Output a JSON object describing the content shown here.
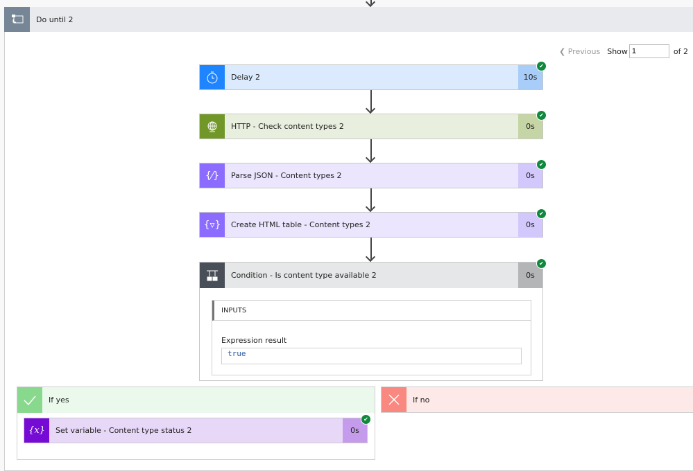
{
  "loop": {
    "title": "Do until 2",
    "icon": "do-until-icon"
  },
  "pager": {
    "previous": "Previous",
    "show": "Show",
    "value": "1",
    "of": "of 2"
  },
  "actions": [
    {
      "title": "Delay 2",
      "duration": "10s",
      "icon": "timer-icon",
      "status": "succeeded",
      "colors": {
        "icon": "#1f85ff",
        "body": "#dceafd",
        "duration": "#a8cdf9"
      }
    },
    {
      "title": "HTTP - Check content types 2",
      "duration": "0s",
      "icon": "globe-icon",
      "status": "succeeded",
      "colors": {
        "icon": "#709727",
        "body": "#e9efdf",
        "duration": "#c6d5a5"
      }
    },
    {
      "title": "Parse JSON - Content types 2",
      "duration": "0s",
      "icon": "braces-icon",
      "status": "succeeded",
      "colors": {
        "icon": "#8c6cff",
        "body": "#ebe5fd",
        "duration": "#d3c8fb"
      }
    },
    {
      "title": "Create HTML table - Content types 2",
      "duration": "0s",
      "icon": "braces-filter-icon",
      "status": "succeeded",
      "colors": {
        "icon": "#8c6cff",
        "body": "#ebe5fd",
        "duration": "#d3c8fb"
      }
    }
  ],
  "condition": {
    "title": "Condition - Is content type available 2",
    "duration": "0s",
    "inputs_label": "INPUTS",
    "expr_label": "Expression result",
    "expr_value": "true",
    "icon": "condition-icon"
  },
  "if_yes": {
    "label": "If yes",
    "action": {
      "title": "Set variable - Content type status 2",
      "duration": "0s",
      "icon": "variable-icon"
    }
  },
  "if_no": {
    "label": "If no"
  }
}
